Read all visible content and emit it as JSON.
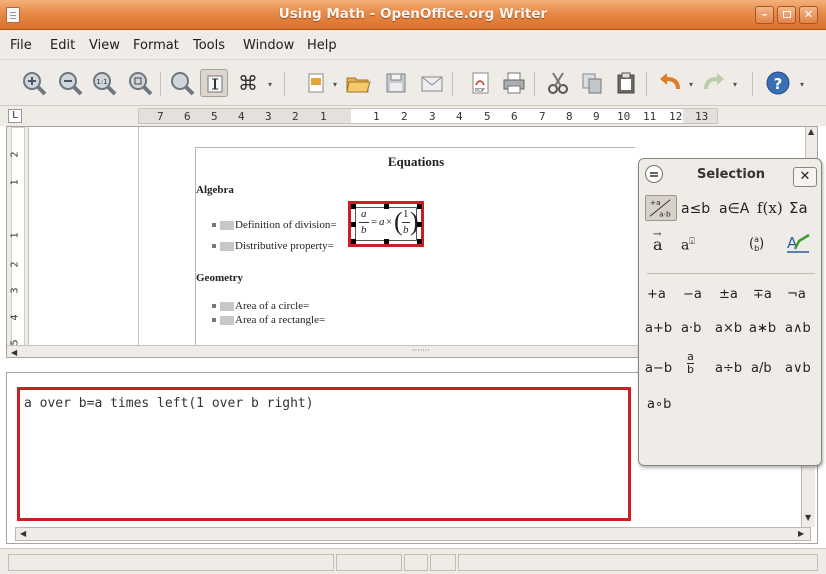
{
  "window": {
    "title": "Using Math - OpenOffice.org Writer",
    "controls": {
      "minimize": "–",
      "maximize": "□",
      "close": "✕"
    }
  },
  "menu": {
    "items": [
      "File",
      "Edit",
      "View",
      "Format",
      "Tools",
      "Window",
      "Help"
    ]
  },
  "toolbar": {
    "icons": [
      "zoom-in-icon",
      "zoom-out-icon",
      "zoom-100-icon",
      "zoom-page-icon",
      "zoom-optimal-icon",
      "formula-cursor-icon",
      "symbols-icon",
      "template-icon",
      "open-icon",
      "save-icon",
      "mail-icon",
      "export-pdf-icon",
      "print-icon",
      "cut-icon",
      "copy-icon",
      "paste-icon",
      "undo-icon",
      "redo-icon",
      "help-icon"
    ]
  },
  "ruler": {
    "corner": "L",
    "numbers": [
      "7",
      "6",
      "5",
      "4",
      "3",
      "2",
      "1",
      "1",
      "2",
      "3",
      "4",
      "5",
      "6",
      "7",
      "8",
      "9",
      "10",
      "11",
      "12",
      "13"
    ]
  },
  "vruler": {
    "numbers": [
      "2",
      "1",
      "1",
      "2",
      "3",
      "4",
      "5"
    ]
  },
  "document": {
    "title": "Equations",
    "sections": [
      {
        "heading": "Algebra",
        "items": [
          "Definition of division=",
          "Distributive property="
        ]
      },
      {
        "heading": "Geometry",
        "items": [
          "Area of a circle=",
          "Area of a rectangle="
        ]
      }
    ],
    "formula": {
      "lhs_num": "a",
      "lhs_den": "b",
      "eq": "=",
      "a": "a",
      "times": "×",
      "frac_num": "1",
      "frac_den": "b"
    }
  },
  "command": {
    "text": "a over b=a times left(1 over b right)"
  },
  "palette": {
    "title": "Selection",
    "close": "✕",
    "categories": [
      {
        "label": "+a/a·b",
        "name": "unary-binary-operators"
      },
      {
        "label": "a≤b",
        "name": "relations"
      },
      {
        "label": "a∈A",
        "name": "set-operations"
      },
      {
        "label": "f(x)",
        "name": "functions"
      },
      {
        "label": "Σa",
        "name": "operators"
      },
      {
        "label": "a⃗",
        "name": "attributes"
      },
      {
        "label": "aᵂ",
        "name": "others"
      },
      {
        "label": "(ᵃ/ᵦ)",
        "name": "brackets"
      },
      {
        "label": "A̲",
        "name": "formats"
      }
    ],
    "operators": [
      [
        "+a",
        "−a",
        "±a",
        "∓a",
        "¬a"
      ],
      [
        "a+b",
        "a·b",
        "a×b",
        "a∗b",
        "a∧b"
      ],
      [
        "a−b",
        "a/b frac",
        "a÷b",
        "a/b",
        "a∨b"
      ],
      [
        "a∘b"
      ]
    ]
  },
  "colors": {
    "titlebar": "#e88a48",
    "highlight": "#cc1f24",
    "panel": "#efebe7"
  }
}
